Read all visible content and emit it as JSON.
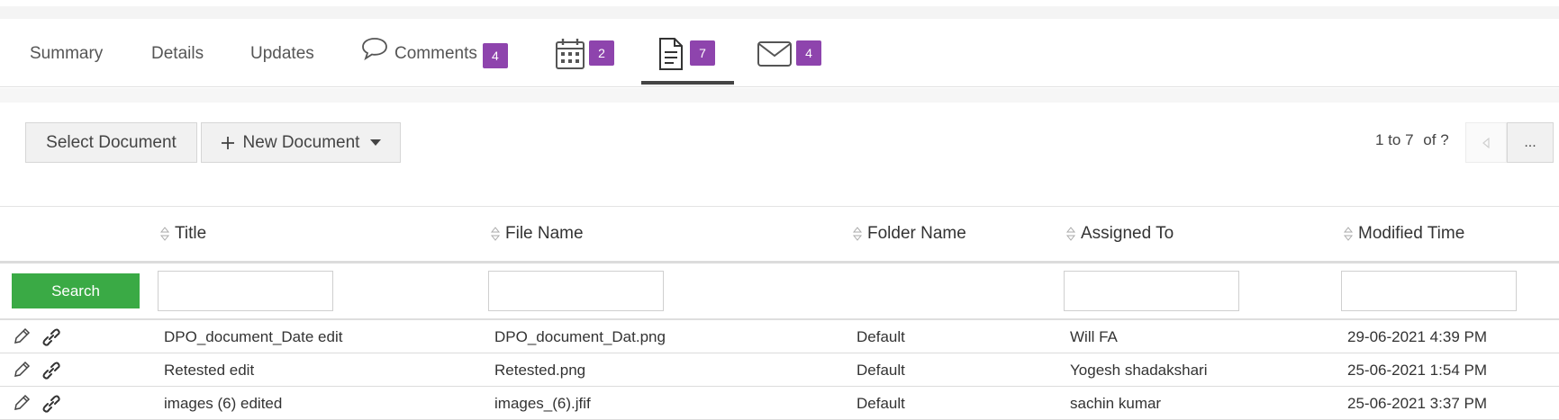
{
  "tabs": {
    "summary": "Summary",
    "details": "Details",
    "updates": "Updates",
    "comments": "Comments",
    "comments_count": "4",
    "calendar_count": "2",
    "documents_count": "7",
    "mail_count": "4",
    "badge_color": "#8e44ad"
  },
  "toolbar": {
    "select_document": "Select Document",
    "new_document": "New Document",
    "new_document_icon": "plus-icon"
  },
  "pager": {
    "range": "1 to 7",
    "of": "of",
    "total": "?",
    "more": "..."
  },
  "table": {
    "columns": [
      "Title",
      "File Name",
      "Folder Name",
      "Assigned To",
      "Modified Time"
    ],
    "search_label": "Search",
    "search_color": "#3aaa45",
    "rows": [
      {
        "title": "DPO_document_Date edit",
        "file_name": "DPO_document_Dat.png",
        "folder": "Default",
        "assigned_to": "Will FA",
        "modified": "29-06-2021 4:39 PM"
      },
      {
        "title": "Retested edit",
        "file_name": "Retested.png",
        "folder": "Default",
        "assigned_to": "Yogesh shadakshari",
        "modified": "25-06-2021 1:54 PM"
      },
      {
        "title": "images (6) edited",
        "file_name": "images_(6).jfif",
        "folder": "Default",
        "assigned_to": "sachin kumar",
        "modified": "25-06-2021 3:37 PM"
      }
    ]
  }
}
